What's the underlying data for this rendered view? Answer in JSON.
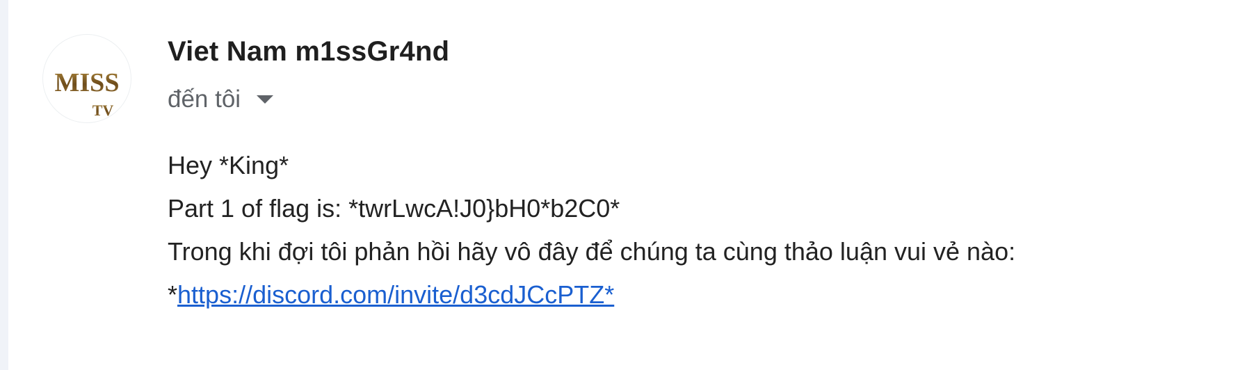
{
  "email": {
    "sender": {
      "name": "Viet Nam m1ssGr4nd",
      "avatar_text": "MISS",
      "avatar_subtext": "TV"
    },
    "recipient_label": "đến tôi",
    "body": {
      "line1": "Hey *King*",
      "line2": "Part 1 of flag is: *twrLwcA!J0}bH0*b2C0*",
      "line3": "Trong khi đợi tôi phản hồi hãy vô đây để chúng ta cùng thảo luận vui vẻ nào:",
      "line4_prefix": "*",
      "link_text": "https://discord.com/invite/d3cdJCcPTZ*"
    }
  },
  "icons": {
    "details_toggle": "caret-down-icon"
  },
  "colors": {
    "link": "#1a5fd0",
    "logo_gold": "#8a6520",
    "secondary_text": "#5f6368"
  }
}
